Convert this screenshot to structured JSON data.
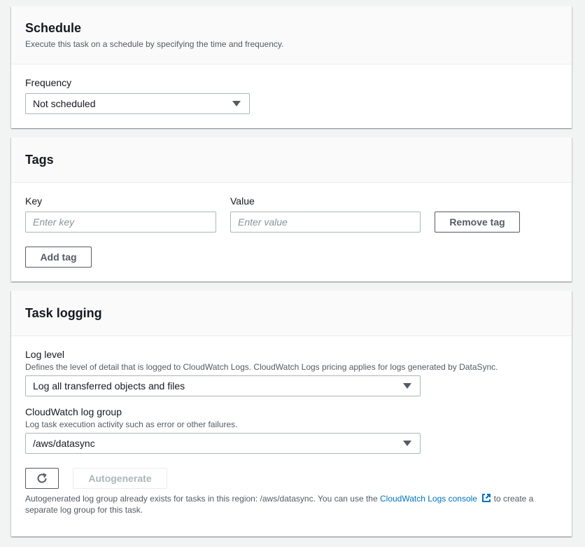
{
  "schedule": {
    "title": "Schedule",
    "description": "Execute this task on a schedule by specifying the time and frequency.",
    "frequency_label": "Frequency",
    "frequency_value": "Not scheduled"
  },
  "tags": {
    "title": "Tags",
    "key_label": "Key",
    "value_label": "Value",
    "key_placeholder": "Enter key",
    "value_placeholder": "Enter value",
    "remove_tag_label": "Remove tag",
    "add_tag_label": "Add tag"
  },
  "task_logging": {
    "title": "Task logging",
    "log_level_label": "Log level",
    "log_level_description": "Defines the level of detail that is logged to CloudWatch Logs. CloudWatch Logs pricing applies for logs generated by DataSync.",
    "log_level_value": "Log all transferred objects and files",
    "log_group_label": "CloudWatch log group",
    "log_group_description": "Log task execution activity such as error or other failures.",
    "log_group_value": "/aws/datasync",
    "autogenerate_label": "Autogenerate",
    "helper_text_before": "Autogenerated log group already exists for tasks in this region: /aws/datasync. You can use the ",
    "helper_link": "CloudWatch Logs console",
    "helper_text_after": " to create a separate log group for this task."
  },
  "colors": {
    "link": "#0073bb",
    "text": "#16191f",
    "secondary_text": "#545b64",
    "border": "#aab7b8"
  }
}
